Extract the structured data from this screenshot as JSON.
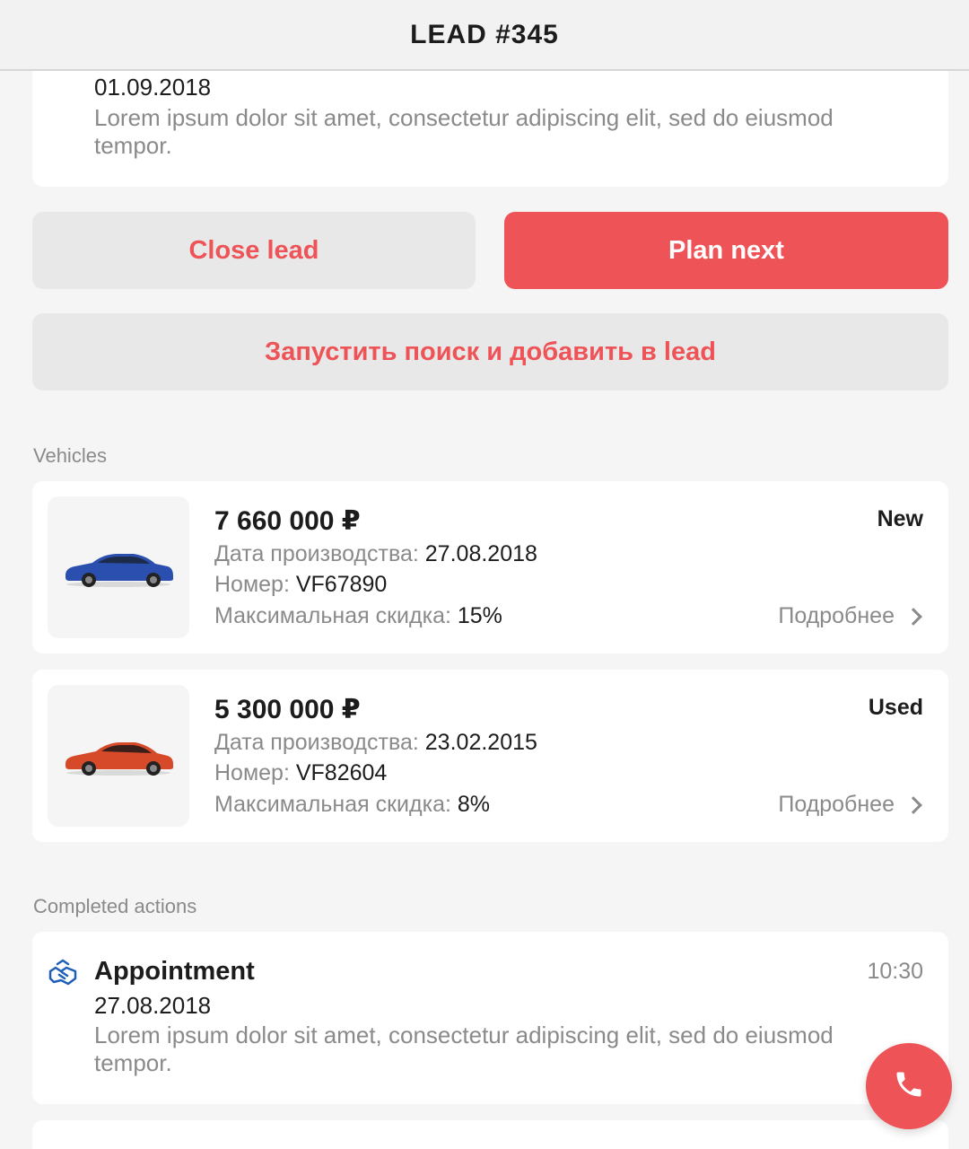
{
  "header": {
    "title": "LEAD #345"
  },
  "top_action": {
    "date": "01.09.2018",
    "text": "Lorem ipsum dolor sit amet, consectetur adipiscing elit, sed do eiusmod tempor."
  },
  "buttons": {
    "close_lead": "Close lead",
    "plan_next": "Plan next",
    "search": "Запустить поиск и добавить в lead"
  },
  "vehicles": {
    "section_label": "Vehicles",
    "items": [
      {
        "price": "7 660 000 ₽",
        "status": "New",
        "date_label": "Дата производства:",
        "date_value": "27.08.2018",
        "number_label": "Номер:",
        "number_value": "VF67890",
        "discount_label": "Максимальная скидка:",
        "discount_value": "15%",
        "more_label": "Подробнее",
        "car_color": "#2a4fae"
      },
      {
        "price": "5 300 000 ₽",
        "status": "Used",
        "date_label": "Дата производства:",
        "date_value": "23.02.2015",
        "number_label": "Номер:",
        "number_value": "VF82604",
        "discount_label": "Максимальная скидка:",
        "discount_value": "8%",
        "more_label": "Подробнее",
        "car_color": "#d64a2a"
      }
    ]
  },
  "completed": {
    "section_label": "Completed actions",
    "items": [
      {
        "icon": "handshake-icon",
        "title": "Appointment",
        "time": "10:30",
        "date": "27.08.2018",
        "text": "Lorem ipsum dolor sit amet, consectetur adipiscing elit, sed do eiusmod tempor."
      }
    ]
  },
  "fab": {
    "icon": "phone-icon"
  },
  "colors": {
    "accent": "#ee5457",
    "secondary_button": "#e8e8e8",
    "muted_text": "#8a8a8a"
  }
}
